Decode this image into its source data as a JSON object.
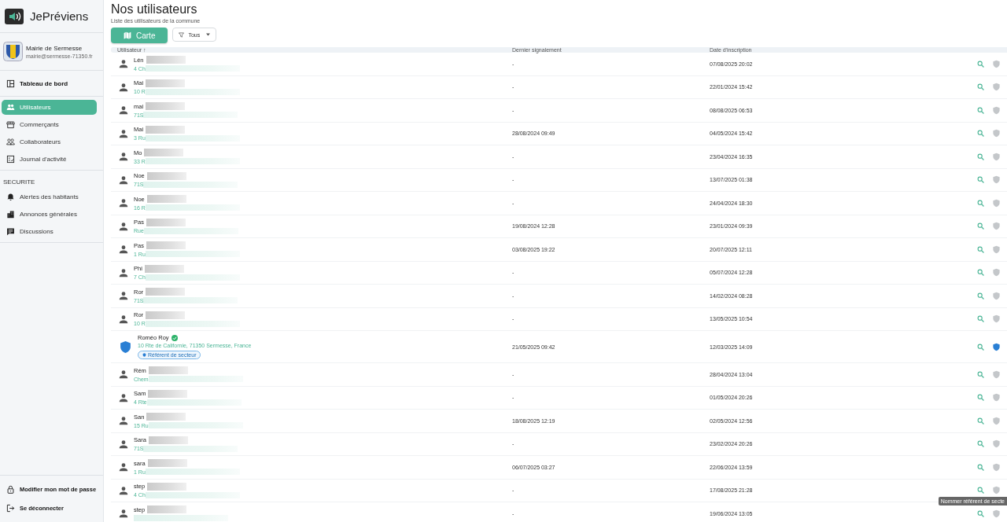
{
  "app": {
    "name": "JePréviens"
  },
  "organization": {
    "name": "Mairie de Sermesse",
    "email": "mairie@sermesse-71350.fr"
  },
  "nav": [
    {
      "items": [
        {
          "label": "Tableau de bord",
          "selected": false
        }
      ]
    },
    {
      "items": [
        {
          "label": "Utilisateurs",
          "selected": true
        },
        {
          "label": "Commerçants",
          "selected": false
        },
        {
          "label": "Collaborateurs",
          "selected": false
        },
        {
          "label": "Journal d'activité",
          "selected": false
        }
      ]
    },
    {
      "section": "SECURITE",
      "items": [
        {
          "label": "Alertes des habitants",
          "selected": false
        },
        {
          "label": "Annonces générales",
          "selected": false
        },
        {
          "label": "Discussions",
          "selected": false
        }
      ]
    }
  ],
  "account": [
    {
      "label": "Modifier mon mot de passe"
    },
    {
      "label": "Se déconnecter"
    }
  ],
  "page": {
    "title": "Nos utilisateurs",
    "subtitle": "Liste des utilisateurs de la commune"
  },
  "toolbar": {
    "map_button": "Carte",
    "filter": {
      "value": "Tous"
    }
  },
  "table": {
    "columns": [
      {
        "label": "Utilisateur",
        "sort": "↑"
      },
      {
        "label": "Dernier signalement"
      },
      {
        "label": "Date d'inscription"
      }
    ],
    "rows": [
      {
        "name": "Lén",
        "address": "4 Ch",
        "last_report": "-",
        "registered": "07/08/2025 20:02",
        "referent": false,
        "blurred": true
      },
      {
        "name": "Mai",
        "address": "10 R",
        "last_report": "-",
        "registered": "22/01/2024 15:42",
        "referent": false,
        "blurred": true
      },
      {
        "name": "mai",
        "address": "71S",
        "last_report": "-",
        "registered": "08/08/2025 06:53",
        "referent": false,
        "blurred": true
      },
      {
        "name": "Mai",
        "address": "3 Ru",
        "last_report": "28/08/2024 09:49",
        "registered": "04/05/2024 15:42",
        "referent": false,
        "blurred": true
      },
      {
        "name": "Mo",
        "address": "33 R",
        "last_report": "-",
        "registered": "23/04/2024 16:35",
        "referent": false,
        "blurred": true
      },
      {
        "name": "Noe",
        "address": "71S",
        "last_report": "-",
        "registered": "13/07/2025 01:38",
        "referent": false,
        "blurred": true
      },
      {
        "name": "Noe",
        "address": "16 R",
        "last_report": "-",
        "registered": "24/04/2024 18:30",
        "referent": false,
        "blurred": true
      },
      {
        "name": "Pas",
        "address": "Rue",
        "last_report": "19/08/2024 12:28",
        "registered": "23/01/2024 09:39",
        "referent": false,
        "blurred": true
      },
      {
        "name": "Pas",
        "address": "1 Ru",
        "last_report": "03/08/2025 19:22",
        "registered": "20/07/2025 12:11",
        "referent": false,
        "blurred": true
      },
      {
        "name": "Phi",
        "address": "7 Ch",
        "last_report": "-",
        "registered": "05/07/2024 12:28",
        "referent": false,
        "blurred": true
      },
      {
        "name": "Ror",
        "address": "71S",
        "last_report": "-",
        "registered": "14/02/2024 08:28",
        "referent": false,
        "blurred": true
      },
      {
        "name": "Ror",
        "address": "10 R",
        "last_report": "-",
        "registered": "13/05/2025 10:54",
        "referent": false,
        "blurred": true
      },
      {
        "name": "Roméo Roy",
        "address": "10 Rte de Californie, 71350 Sermesse, France",
        "badge": "Référent de secteur",
        "last_report": "21/05/2025 09:42",
        "registered": "12/03/2025 14:09",
        "referent": true,
        "verified": true,
        "blurred": false
      },
      {
        "name": "Rém",
        "address": "Chem",
        "last_report": "-",
        "registered": "28/04/2024 13:04",
        "referent": false,
        "blurred": true
      },
      {
        "name": "Sam",
        "address": "4 Rte",
        "last_report": "-",
        "registered": "01/05/2024 20:26",
        "referent": false,
        "blurred": true
      },
      {
        "name": "San",
        "address": "15 Ru",
        "last_report": "18/08/2025 12:19",
        "registered": "02/05/2024 12:56",
        "referent": false,
        "blurred": true
      },
      {
        "name": "Sara",
        "address": "71S",
        "last_report": "-",
        "registered": "23/02/2024 20:26",
        "referent": false,
        "blurred": true
      },
      {
        "name": "sara",
        "address": "1 Ru",
        "last_report": "06/07/2025 03:27",
        "registered": "22/06/2024 13:59",
        "referent": false,
        "blurred": true
      },
      {
        "name": "step",
        "address": "4 Ch",
        "last_report": "-",
        "registered": "17/08/2025 21:28",
        "referent": false,
        "blurred": true
      },
      {
        "name": "step",
        "last_report": "-",
        "registered": "19/06/2024 13:05",
        "referent": false,
        "blurred": true
      }
    ]
  },
  "tooltip": {
    "text": "Nommer référent de secte"
  }
}
